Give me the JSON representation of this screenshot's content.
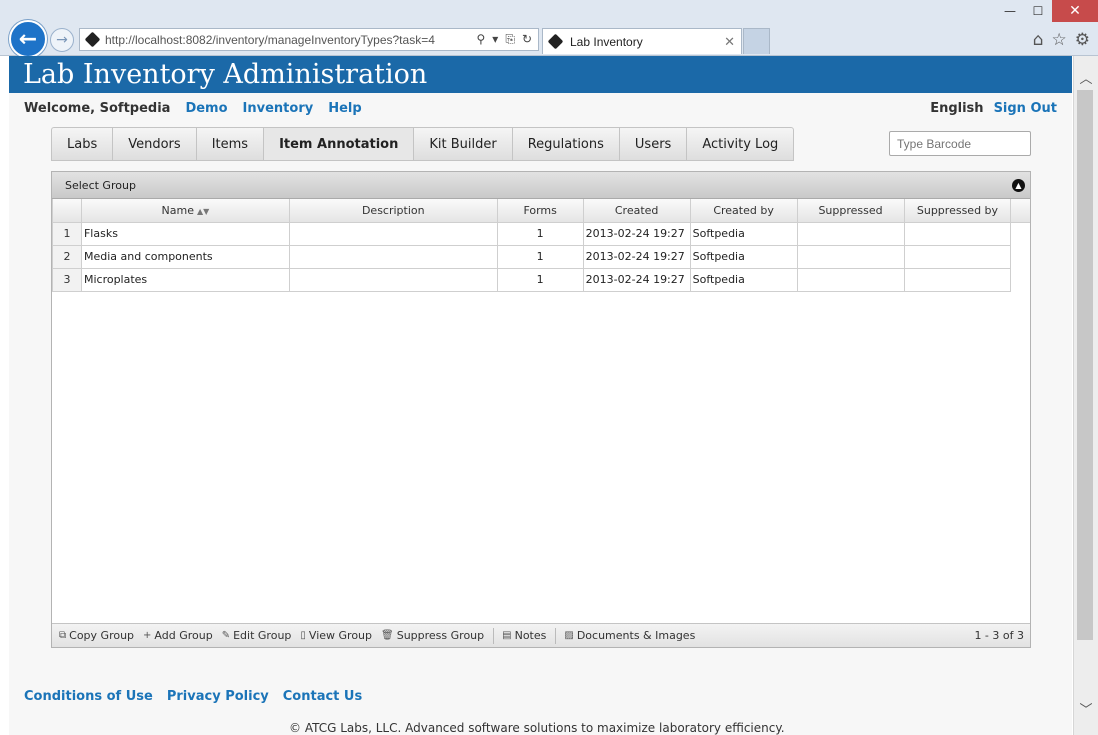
{
  "browser": {
    "url": "http://localhost:8082/inventory/manageInventoryTypes?task=4",
    "tab_title": "Lab Inventory",
    "tab_close": "✕",
    "back_glyph": "←",
    "forward_glyph": "→",
    "window_controls": {
      "minimize": "—",
      "maximize": "☐",
      "close": "✕"
    },
    "address_icons": {
      "search": "⚲",
      "dropdown": "▾",
      "compat": "⎘",
      "refresh": "↻"
    },
    "tools": {
      "home": "⌂",
      "favorites": "☆",
      "settings": "⚙"
    }
  },
  "app": {
    "title": "Lab Inventory Administration",
    "welcome": "Welcome, Softpedia",
    "top_links": [
      "Demo",
      "Inventory",
      "Help"
    ],
    "language": "English",
    "sign_out": "Sign Out"
  },
  "tabs": [
    {
      "label": "Labs",
      "active": false
    },
    {
      "label": "Vendors",
      "active": false
    },
    {
      "label": "Items",
      "active": false
    },
    {
      "label": "Item Annotation",
      "active": true
    },
    {
      "label": "Kit Builder",
      "active": false
    },
    {
      "label": "Regulations",
      "active": false
    },
    {
      "label": "Users",
      "active": false
    },
    {
      "label": "Activity Log",
      "active": false
    }
  ],
  "barcode": {
    "placeholder": "Type Barcode"
  },
  "grid": {
    "caption": "Select Group",
    "columns": [
      "Name",
      "Description",
      "Forms",
      "Created",
      "Created by",
      "Suppressed",
      "Suppressed by"
    ],
    "sort_indicator": "▲▼",
    "rows": [
      {
        "num": "1",
        "name": "Flasks",
        "description": "",
        "forms": "1",
        "created": "2013-02-24 19:27",
        "created_by": "Softpedia",
        "suppressed": "",
        "suppressed_by": ""
      },
      {
        "num": "2",
        "name": "Media and components",
        "description": "",
        "forms": "1",
        "created": "2013-02-24 19:27",
        "created_by": "Softpedia",
        "suppressed": "",
        "suppressed_by": ""
      },
      {
        "num": "3",
        "name": "Microplates",
        "description": "",
        "forms": "1",
        "created": "2013-02-24 19:27",
        "created_by": "Softpedia",
        "suppressed": "",
        "suppressed_by": ""
      }
    ],
    "actions": [
      "Copy Group",
      "Add Group",
      "Edit Group",
      "View Group",
      "Suppress Group",
      "Notes",
      "Documents & Images"
    ],
    "pager": "1 - 3 of 3"
  },
  "footer": {
    "links": [
      "Conditions of Use",
      "Privacy Policy",
      "Contact Us"
    ],
    "copyright": "© ATCG Labs, LLC. Advanced software solutions to maximize laboratory efficiency."
  },
  "colors": {
    "banner": "#1b69a8",
    "link": "#1b74b8",
    "back_button": "#1e73c8"
  }
}
